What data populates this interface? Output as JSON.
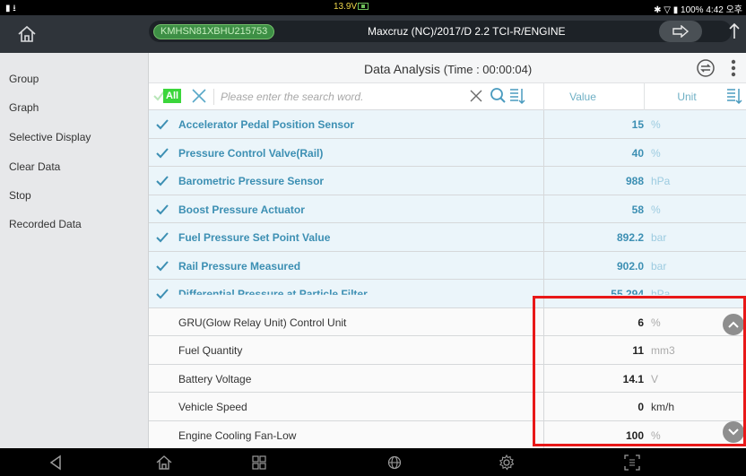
{
  "status_bar": {
    "left_icons": "▮ ⭳",
    "voltage": "13.9V",
    "right": "✱ ▽ ▮ 100% 4:42 오후"
  },
  "header": {
    "vin": "KMHSN81XBHU215753",
    "vehicle": "Maxcruz (NC)/2017/D 2.2 TCI-R/ENGINE"
  },
  "sidebar": {
    "items": [
      {
        "label": "Group"
      },
      {
        "label": "Graph"
      },
      {
        "label": "Selective Display"
      },
      {
        "label": "Clear Data"
      },
      {
        "label": "Stop"
      },
      {
        "label": "Recorded Data"
      }
    ]
  },
  "main": {
    "title": "Data Analysis",
    "time": "(Time : 00:00:04)",
    "all_label": "All",
    "search_placeholder": "Please enter the search word.",
    "col_value": "Value",
    "col_unit": "Unit",
    "rows": [
      {
        "name": "Accelerator Pedal Position Sensor",
        "value": "15",
        "unit": "%",
        "selected": true
      },
      {
        "name": "Pressure Control Valve(Rail)",
        "value": "40",
        "unit": "%",
        "selected": true
      },
      {
        "name": "Barometric Pressure Sensor",
        "value": "988",
        "unit": "hPa",
        "selected": true
      },
      {
        "name": "Boost Pressure Actuator",
        "value": "58",
        "unit": "%",
        "selected": true
      },
      {
        "name": "Fuel Pressure Set Point Value",
        "value": "892.2",
        "unit": "bar",
        "selected": true
      },
      {
        "name": "Rail Pressure Measured",
        "value": "902.0",
        "unit": "bar",
        "selected": true
      },
      {
        "name": "Differential Pressure at Particle Filter",
        "value": "55.294",
        "unit": "hPa",
        "selected": true
      },
      {
        "name": "GRU(Glow Relay Unit) Control Unit",
        "value": "6",
        "unit": "%",
        "selected": false
      },
      {
        "name": "Fuel Quantity",
        "value": "11",
        "unit": "mm3",
        "selected": false
      },
      {
        "name": "Battery Voltage",
        "value": "14.1",
        "unit": "V",
        "selected": false
      },
      {
        "name": "Vehicle Speed",
        "value": "0",
        "unit": "km/h",
        "selected": false
      },
      {
        "name": "Engine Cooling Fan-Low",
        "value": "100",
        "unit": "%",
        "selected": false
      }
    ]
  },
  "colors": {
    "accent": "#3c8fb3",
    "highlight": "#e81818",
    "all_badge": "#3bd63b"
  }
}
